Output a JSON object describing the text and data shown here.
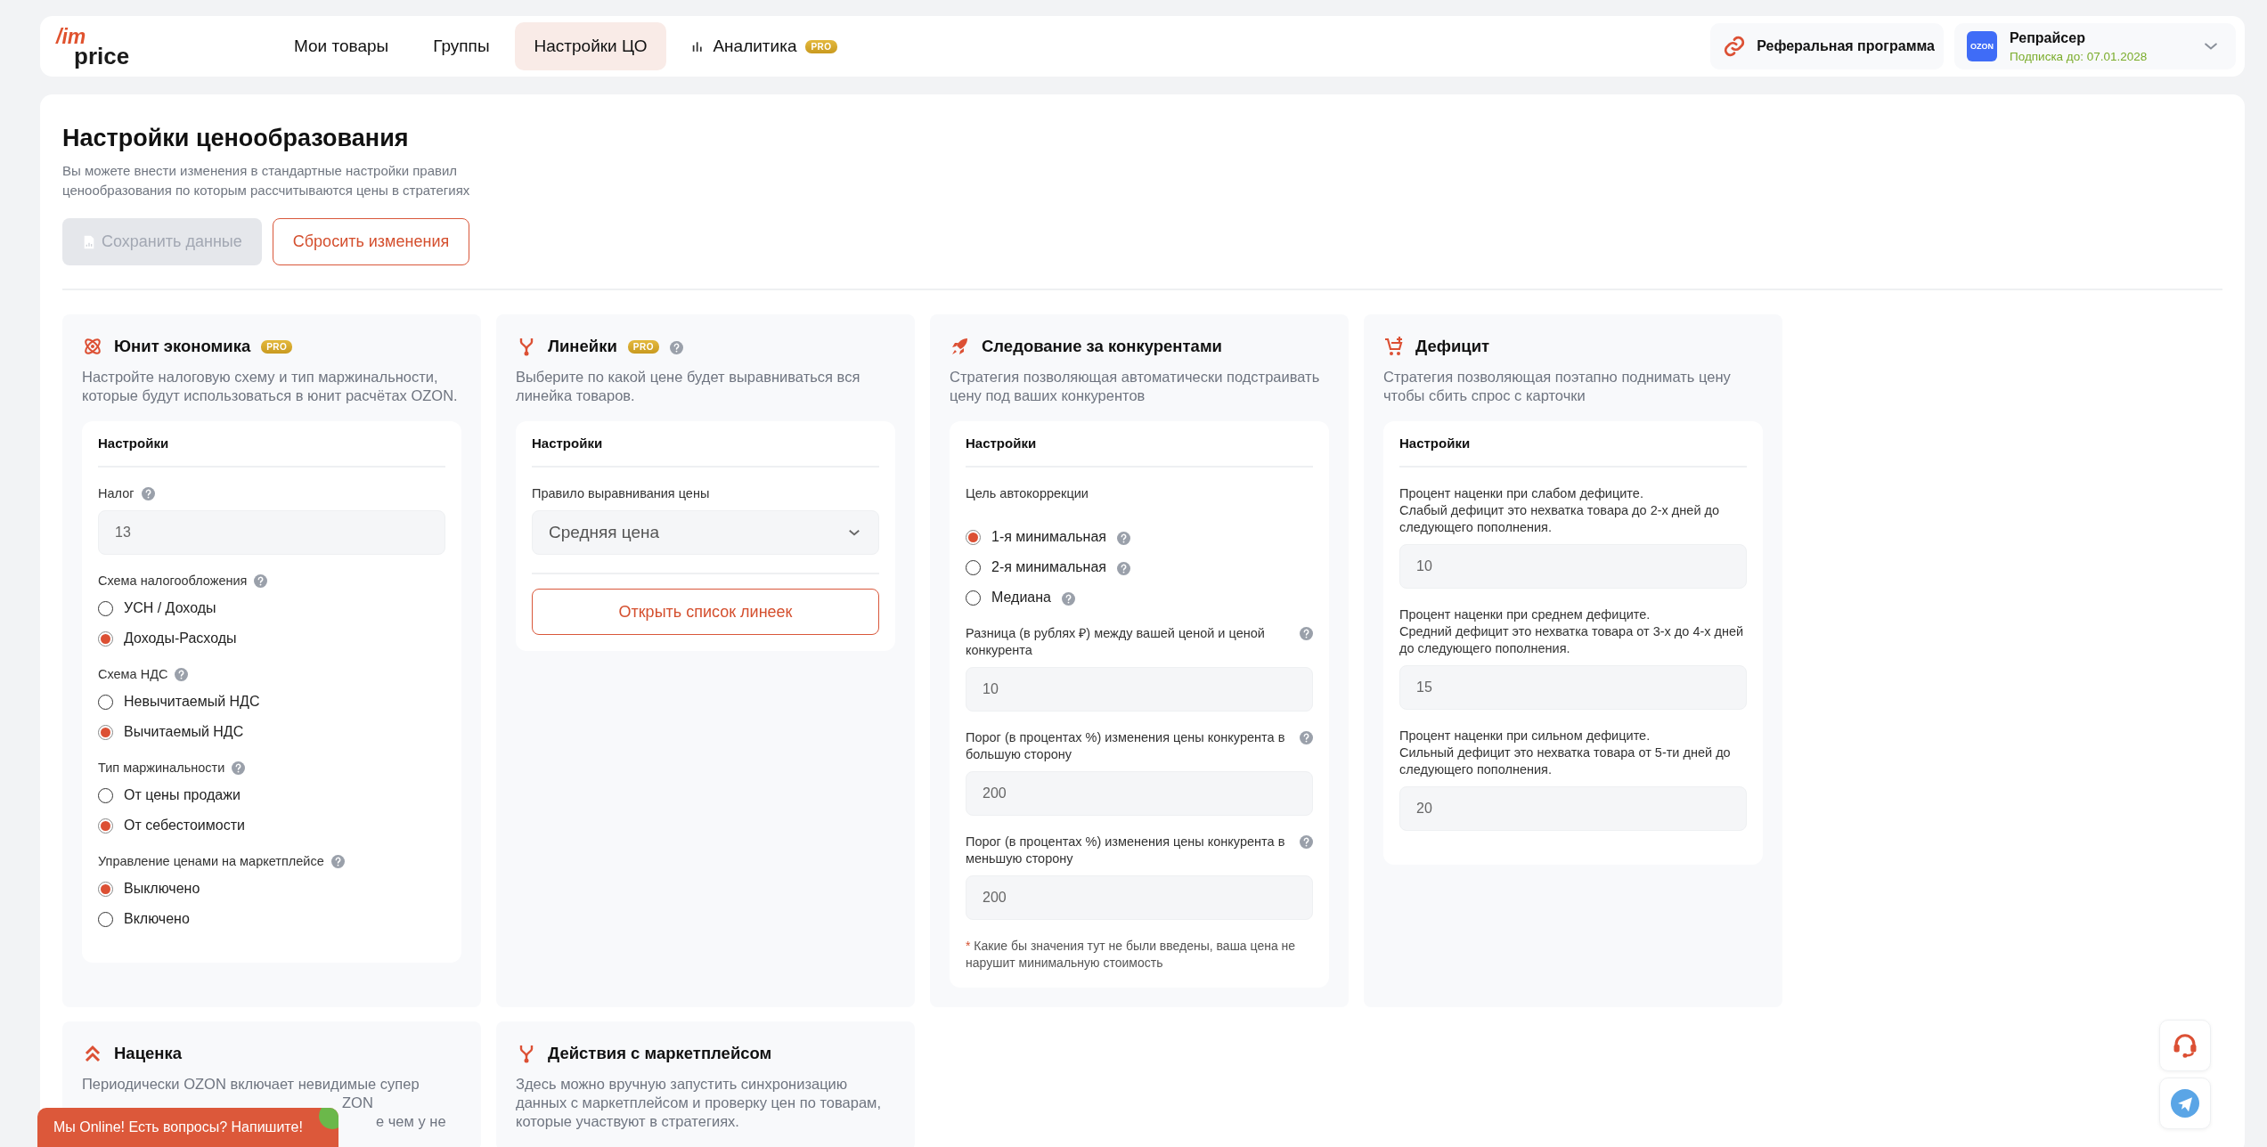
{
  "header": {
    "logo": {
      "top": "/im",
      "bottom": "price"
    },
    "nav": [
      {
        "label": "Мои товары",
        "selected": false
      },
      {
        "label": "Группы",
        "selected": false
      },
      {
        "label": "Настройки ЦО",
        "selected": true
      },
      {
        "label": "Аналитика",
        "selected": false,
        "badge": "PRO"
      }
    ],
    "referral": "Реферальная программа",
    "account": {
      "logo": "OZON",
      "name": "Репрайсер",
      "subscription": "Подписка до: 07.01.2028"
    }
  },
  "page": {
    "title": "Настройки ценообразования",
    "description": "Вы можете внести изменения в стандартные настройки правил ценообразования по которым рассчитываются цены в стратегиях",
    "buttons": [
      {
        "label": "Сохранить данные",
        "kind": "save",
        "disabled": true
      },
      {
        "label": "Сбросить изменения",
        "kind": "reset",
        "disabled": false
      }
    ]
  },
  "cards": [
    {
      "title": "Юнит экономика",
      "badge": "PRO",
      "help": false,
      "description": [
        "Настройте налоговую схему и тип маржинальности, которые будут использоваться в юнит расчётах OZON."
      ],
      "settings": {
        "title": "Настройки",
        "items": [
          {
            "kind": "field",
            "label": [
              "Налог"
            ],
            "help": true,
            "value": "13"
          },
          {
            "kind": "radio_group",
            "label": [
              "Схема налогообложения"
            ],
            "help": true,
            "options": [
              {
                "label": "УСН / Доходы",
                "selected": false,
                "help": false
              },
              {
                "label": "Доходы-Расходы",
                "selected": true,
                "help": false
              }
            ]
          },
          {
            "kind": "radio_group",
            "label": [
              "Схема НДС"
            ],
            "help": true,
            "options": [
              {
                "label": "Невычитаемый НДС",
                "selected": false,
                "help": false
              },
              {
                "label": "Вычитаемый НДС",
                "selected": true,
                "help": false
              }
            ]
          },
          {
            "kind": "radio_group",
            "label": [
              "Тип маржинальности"
            ],
            "help": true,
            "options": [
              {
                "label": "От цены продажи",
                "selected": false,
                "help": false
              },
              {
                "label": "От себестоимости",
                "selected": true,
                "help": false
              }
            ]
          },
          {
            "kind": "radio_group",
            "label": [
              "Управление ценами на маркетплейсе"
            ],
            "help": true,
            "options": [
              {
                "label": "Выключено",
                "selected": true,
                "help": false
              },
              {
                "label": "Включено",
                "selected": false,
                "help": false
              }
            ]
          }
        ]
      }
    },
    {
      "title": "Линейки",
      "badge": "PRO",
      "help": true,
      "description": [
        "Выберите по какой цене будет выравниваться вся линейка товаров."
      ],
      "settings": {
        "title": "Настройки",
        "items": [
          {
            "kind": "select",
            "label": [
              "Правило выравнивания цены"
            ],
            "help": false,
            "value": "Средняя цена"
          },
          {
            "kind": "button",
            "label": "Открыть список линеек"
          }
        ]
      }
    },
    {
      "title": "Следование за конкурентами",
      "help": false,
      "description": [
        "Стратегия позволяющая автоматически подстраивать цену под ваших конкурентов"
      ],
      "settings": {
        "title": "Настройки",
        "items": [
          {
            "kind": "radio_group",
            "label": [
              "Цель автокоррекции"
            ],
            "help": false,
            "options": [
              {
                "label": "1-я минимальная",
                "selected": true,
                "help": true
              },
              {
                "label": "2-я минимальная",
                "selected": false,
                "help": true
              },
              {
                "label": "Медиана",
                "selected": false,
                "help": true
              }
            ]
          },
          {
            "kind": "field",
            "label": [
              "Разница (в рублях ₽) между вашей ценой и ценой конкурента"
            ],
            "help": true,
            "help_right": true,
            "value": "10"
          },
          {
            "kind": "field",
            "label": [
              "Порог (в процентах %) изменения цены конкурента в большую сторону"
            ],
            "help": true,
            "help_right": true,
            "value": "200"
          },
          {
            "kind": "field",
            "label": [
              "Порог (в процентах %) изменения цены конкурента в меньшую сторону"
            ],
            "help": true,
            "help_right": true,
            "value": "200"
          },
          {
            "kind": "note",
            "mark": "*",
            "text": "Какие бы значения тут не были введены, ваша цена не нарушит минимальную стоимость"
          }
        ]
      }
    },
    {
      "title": "Дефицит",
      "help": false,
      "description": [
        "Стратегия позволяющая поэтапно поднимать цену чтобы сбить спрос с карточки"
      ],
      "settings": {
        "title": "Настройки",
        "items": [
          {
            "kind": "field",
            "label": [
              "Процент наценки при слабом дефиците.",
              "Слабый дефицит это нехватка товара до 2-х дней до следующего пополнения."
            ],
            "help": false,
            "value": "10"
          },
          {
            "kind": "field",
            "label": [
              "Процент наценки при среднем дефиците.",
              "Средний дефицит это нехватка товара от 3-х до 4-х дней до следующего пополнения."
            ],
            "help": false,
            "value": "15"
          },
          {
            "kind": "field",
            "label": [
              "Процент наценки при сильном дефиците.",
              "Сильный дефицит это нехватка товара от 5-ти дней до следующего пополнения."
            ],
            "help": false,
            "value": "20"
          }
        ]
      }
    },
    {
      "title": "Наценка",
      "help": false,
      "description": [
        "Периодически OZON включает невидимые супер",
        "ZON",
        "е чем у не"
      ]
    },
    {
      "title": "Действия с маркетплейсом",
      "help": false,
      "description": [
        "Здесь можно вручную запустить синхронизацию данных с маркетплейсом и проверку цен по товарам, которые участвуют в стратегиях."
      ]
    }
  ],
  "chat_banner": "Мы Online! Есть вопросы? Напишите!"
}
